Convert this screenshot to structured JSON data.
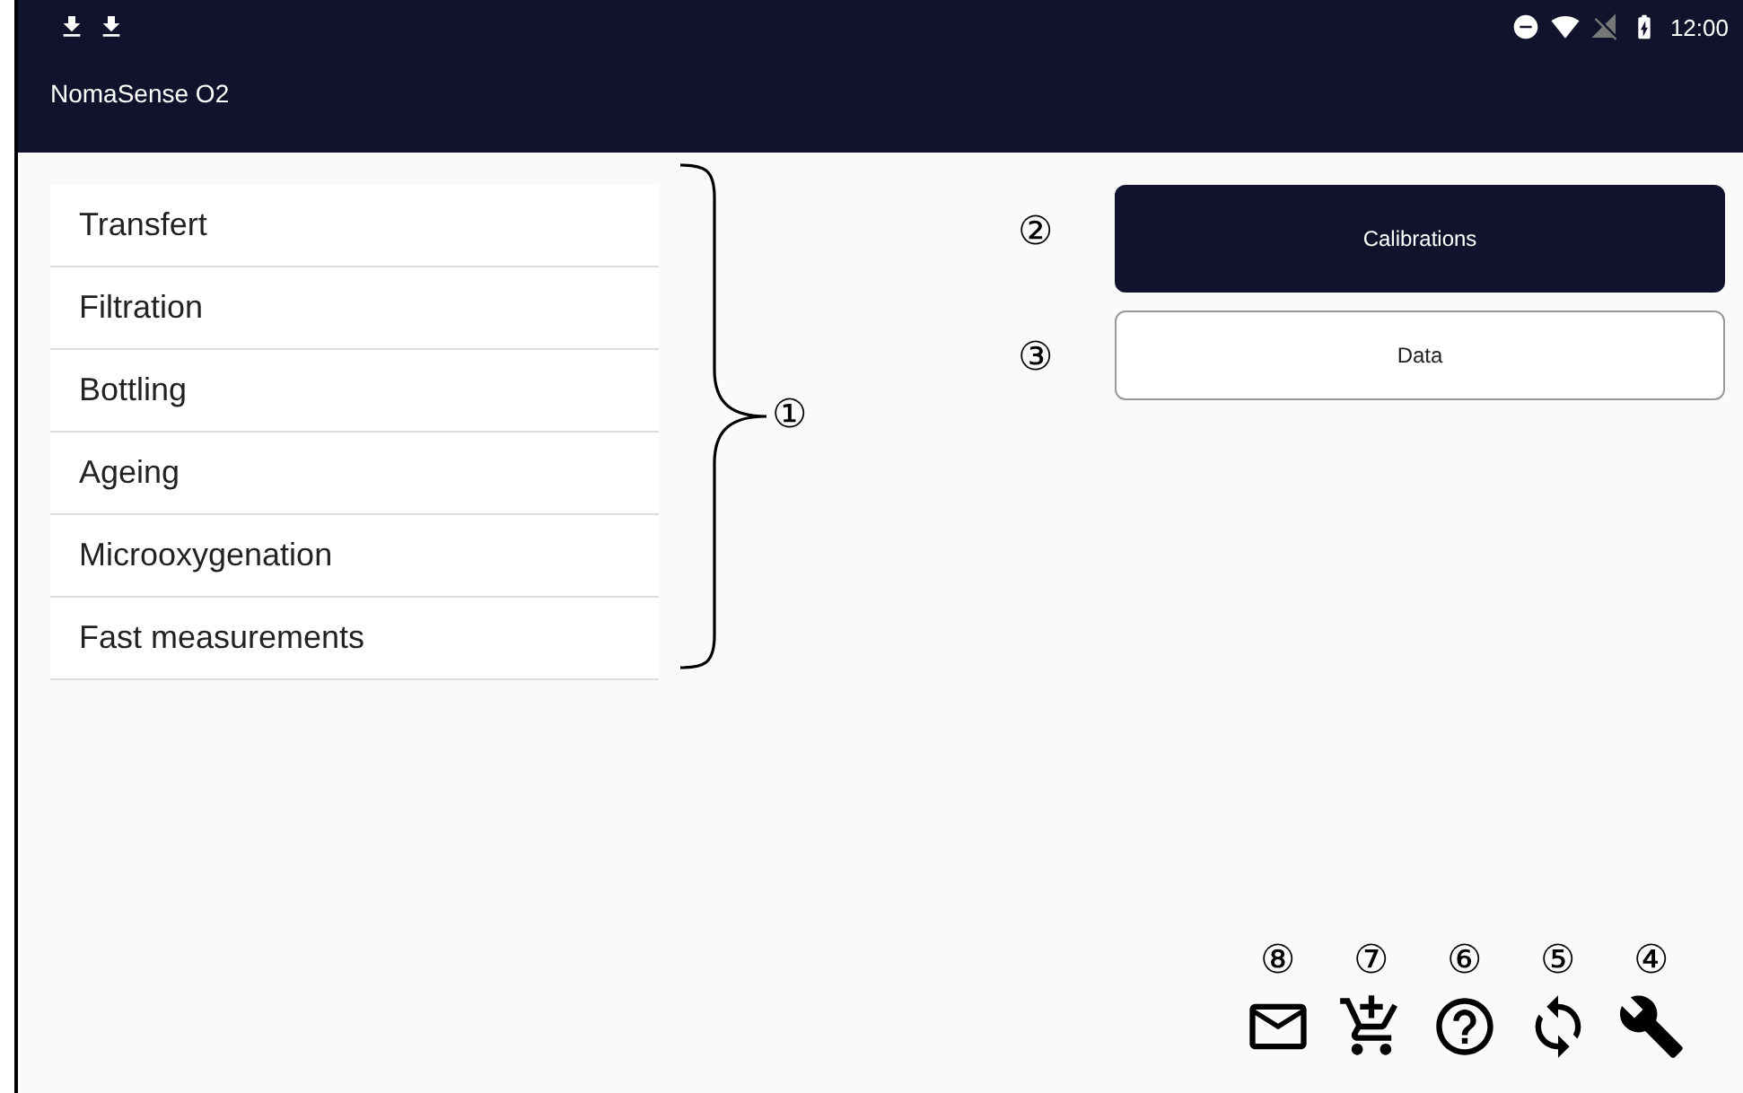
{
  "status_bar": {
    "time": "12:00"
  },
  "app_bar": {
    "title": "NomaSense O2"
  },
  "menu": [
    {
      "label": "Transfert"
    },
    {
      "label": "Filtration"
    },
    {
      "label": "Bottling"
    },
    {
      "label": "Ageing"
    },
    {
      "label": "Microoxygenation"
    },
    {
      "label": "Fast measurements"
    }
  ],
  "menu_callout": "①",
  "buttons": [
    {
      "label": "Calibrations",
      "primary": true,
      "callout": "②"
    },
    {
      "label": "Data",
      "primary": false,
      "callout": "③"
    }
  ],
  "toolbar": [
    {
      "kind": "mail",
      "callout": "⑧"
    },
    {
      "kind": "cart",
      "callout": "⑦"
    },
    {
      "kind": "help",
      "callout": "⑥"
    },
    {
      "kind": "sync",
      "callout": "⑤"
    },
    {
      "kind": "wrench",
      "callout": "④"
    }
  ]
}
